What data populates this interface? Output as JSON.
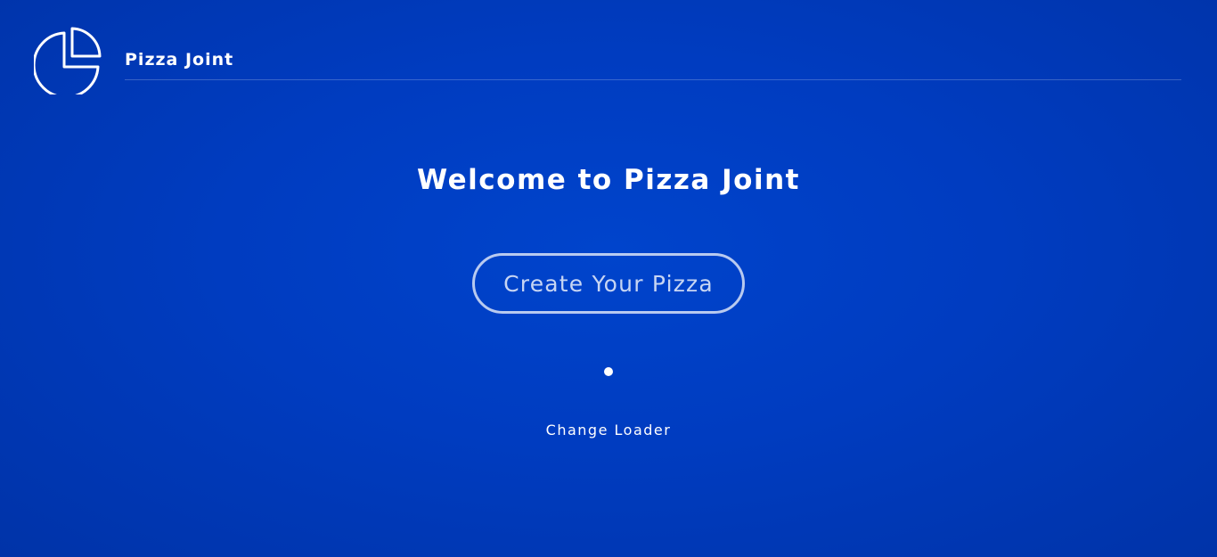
{
  "header": {
    "brand": "Pizza Joint",
    "logo_icon": "pizza-slice-icon"
  },
  "main": {
    "title": "Welcome to Pizza Joint",
    "cta_label": "Create Your Pizza",
    "loader_icon": "loader-dot-icon",
    "change_loader_label": "Change Loader"
  },
  "colors": {
    "background": "#003cc0",
    "text": "#ffffff"
  }
}
